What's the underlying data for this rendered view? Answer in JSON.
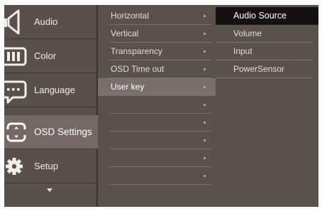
{
  "sidebar": {
    "items": [
      {
        "label": "Audio",
        "icon": "speaker-icon"
      },
      {
        "label": "Color",
        "icon": "color-icon"
      },
      {
        "label": "Language",
        "icon": "speech-bubble-icon"
      },
      {
        "label": "OSD Settings",
        "icon": "osd-frame-icon",
        "active": true
      },
      {
        "label": "Setup",
        "icon": "gear-icon"
      }
    ],
    "more_icon": "chevron-down-icon"
  },
  "submenu": {
    "items": [
      {
        "label": "Horizontal"
      },
      {
        "label": "Vertical"
      },
      {
        "label": "Transparency"
      },
      {
        "label": "OSD Time out"
      },
      {
        "label": "User key",
        "selected": true
      },
      {
        "label": ""
      },
      {
        "label": ""
      },
      {
        "label": ""
      },
      {
        "label": ""
      },
      {
        "label": ""
      }
    ]
  },
  "options": {
    "items": [
      {
        "label": "Audio Source",
        "highlighted": true
      },
      {
        "label": "Volume"
      },
      {
        "label": "Input"
      },
      {
        "label": "PowerSensor"
      }
    ]
  },
  "colors": {
    "panel": "#5b514c",
    "active_category": "#746964",
    "selected_row": "#7a6f6a",
    "highlight_option": "#141110"
  }
}
